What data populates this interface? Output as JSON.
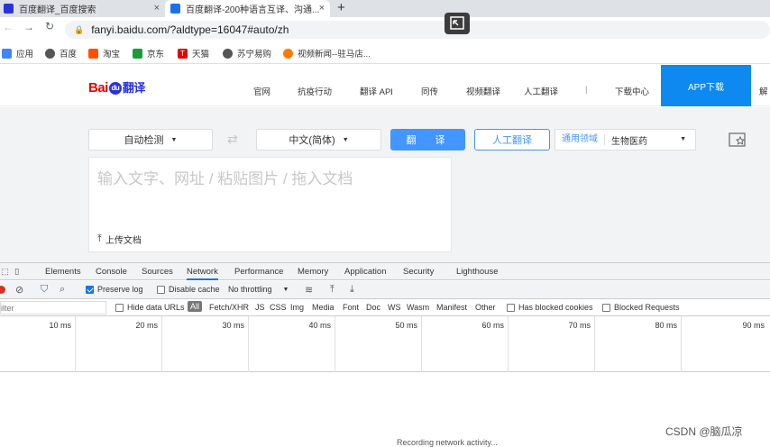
{
  "browser": {
    "tabs": [
      {
        "title": "百度翻译_百度搜索",
        "favicon_color": "#2932e1"
      },
      {
        "title": "百度翻译-200种语言互译、沟通...",
        "favicon_color": "#1a73e8"
      }
    ],
    "new_tab": "+",
    "close": "×",
    "url": "fanyi.baidu.com/?aldtype=16047#auto/zh",
    "nav": {
      "back": "←",
      "forward": "→",
      "reload": "↻"
    },
    "bookmarks": [
      {
        "label": "应用",
        "color": "#4285f4"
      },
      {
        "label": "百度",
        "color": "#555555"
      },
      {
        "label": "淘宝",
        "color": "#ff5000"
      },
      {
        "label": "京东",
        "color": "#1a9b3c"
      },
      {
        "label": "天猫",
        "color": "#e10602"
      },
      {
        "label": "苏宁易购",
        "color": "#555555"
      },
      {
        "label": "视频新闻--驻马店...",
        "color": "#ff7a00"
      }
    ]
  },
  "site": {
    "logo": {
      "bai": "Bai",
      "du": "du",
      "fanyi": "翻译"
    },
    "nav": [
      "官网",
      "抗疫行动",
      "翻译 API",
      "同传",
      "视频翻译",
      "人工翻译",
      "|",
      "下载中心"
    ],
    "app_download": "APP下载",
    "cut_link": "解"
  },
  "translator": {
    "source_lang": "自动检测",
    "target_lang": "中文(简体)",
    "translate_button": "翻　译",
    "human_button": "人工翻译",
    "domain_label": "通用领域",
    "domain_value": "生物医药",
    "input_placeholder": "输入文字、网址 / 粘贴图片 / 拖入文档",
    "upload": "上传文档",
    "caret": "▼",
    "swap": "⇄"
  },
  "devtools": {
    "tabs": [
      "Elements",
      "Console",
      "Sources",
      "Network",
      "Performance",
      "Memory",
      "Application",
      "Security",
      "Lighthouse"
    ],
    "toolbar": {
      "preserve_log": "Preserve log",
      "disable_cache": "Disable cache",
      "throttling": "No throttling"
    },
    "filter": {
      "placeholder": "ilter",
      "hide_data_urls": "Hide data URLs",
      "types": [
        "All",
        "Fetch/XHR",
        "JS",
        "CSS",
        "Img",
        "Media",
        "Font",
        "Doc",
        "WS",
        "Wasm",
        "Manifest",
        "Other"
      ],
      "has_blocked_cookies": "Has blocked cookies",
      "blocked_requests": "Blocked Requests"
    },
    "timeline_ticks": [
      "10 ms",
      "20 ms",
      "30 ms",
      "40 ms",
      "50 ms",
      "60 ms",
      "70 ms",
      "80 ms",
      "90 ms"
    ],
    "recording": "Recording network activity..."
  },
  "watermark": "CSDN @脑瓜凉"
}
